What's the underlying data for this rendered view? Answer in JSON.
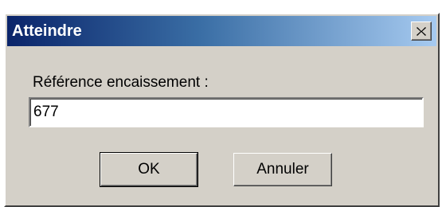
{
  "window": {
    "title": "Atteindre",
    "close_icon": "close-icon"
  },
  "form": {
    "label": "Référence encaissement :",
    "value": "677"
  },
  "buttons": {
    "ok_label": "OK",
    "cancel_label": "Annuler"
  },
  "colors": {
    "titlebar_start": "#0a246a",
    "titlebar_end": "#a6caf0",
    "dialog_face": "#d4d0c8"
  }
}
